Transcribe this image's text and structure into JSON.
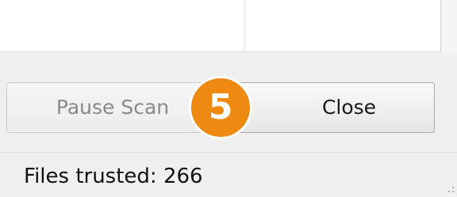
{
  "dialog": {
    "buttons": {
      "pause_label": "Pause Scan",
      "close_label": "Close"
    },
    "callout_number": "5",
    "status": {
      "files_trusted_text": "Files trusted: 266"
    }
  },
  "colors": {
    "callout_badge": "#ee8a12",
    "disabled_text": "#8a8a8a",
    "window_background": "#f0f0f0"
  },
  "icons": [
    "resize-grip-icon"
  ]
}
